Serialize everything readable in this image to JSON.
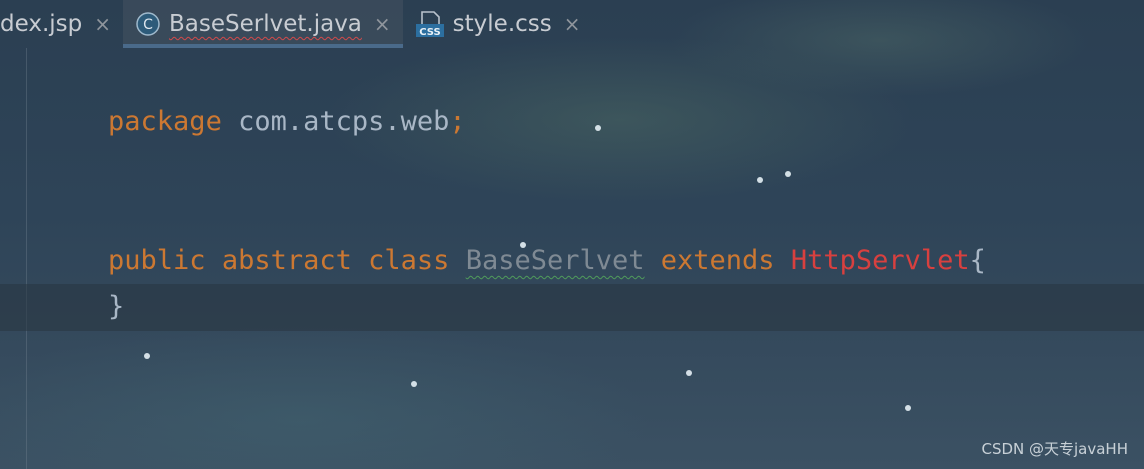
{
  "tabs": [
    {
      "label": "dex.jsp",
      "icon": "",
      "active": false,
      "error": false,
      "close": "×"
    },
    {
      "label": "BaseSerlvet.java",
      "icon": "java-class-icon",
      "active": true,
      "error": true,
      "close": "×"
    },
    {
      "label": "style.css",
      "icon": "css-file-icon",
      "active": false,
      "error": false,
      "close": "×"
    }
  ],
  "icons": {
    "java_class_letter": "C",
    "css_badge": "CSS"
  },
  "code": {
    "line1": {
      "keyword": "package",
      "name": " com.atcps.web",
      "semi": ";"
    },
    "line2": {
      "kw_public": "public",
      "kw_abstract": " abstract",
      "kw_class": " class",
      "class_name": "BaseSerlvet",
      "kw_extends": " extends",
      "parent": "HttpServlet",
      "open_brace": "{"
    },
    "line3": {
      "close_brace": "}"
    }
  },
  "colors": {
    "keyword": "#cc7832",
    "identifier": "#a9b7c6",
    "unused_class": "#7f8a94",
    "error_class": "#d8403f"
  },
  "watermark": "CSDN @天专javaHH"
}
